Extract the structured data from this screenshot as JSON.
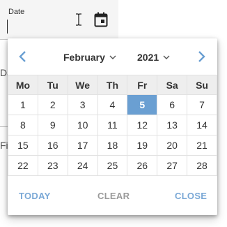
{
  "field": {
    "label": "Date",
    "value": ""
  },
  "background_fragments": [
    "Da",
    "Fi"
  ],
  "picker": {
    "month": "February",
    "year": "2021",
    "weekdays": [
      "Mo",
      "Tu",
      "We",
      "Th",
      "Fr",
      "Sa",
      "Su"
    ],
    "weeks": [
      [
        "1",
        "2",
        "3",
        "4",
        "5",
        "6",
        "7"
      ],
      [
        "8",
        "9",
        "10",
        "11",
        "12",
        "13",
        "14"
      ],
      [
        "15",
        "16",
        "17",
        "18",
        "19",
        "20",
        "21"
      ],
      [
        "22",
        "23",
        "24",
        "25",
        "26",
        "27",
        "28"
      ]
    ],
    "selected_day": "5",
    "footer": {
      "today": "TODAY",
      "clear": "CLEAR",
      "close": "CLOSE"
    }
  },
  "colors": {
    "accent": "#6a9fd2",
    "link": "#7aa8d6",
    "muted": "#9a9a9a"
  },
  "icons": {
    "calendar": "calendar-icon",
    "text_cursor": "text-cursor-icon",
    "prev": "chevron-left-icon",
    "next": "chevron-right-icon",
    "dropdown": "chevron-down-icon"
  }
}
